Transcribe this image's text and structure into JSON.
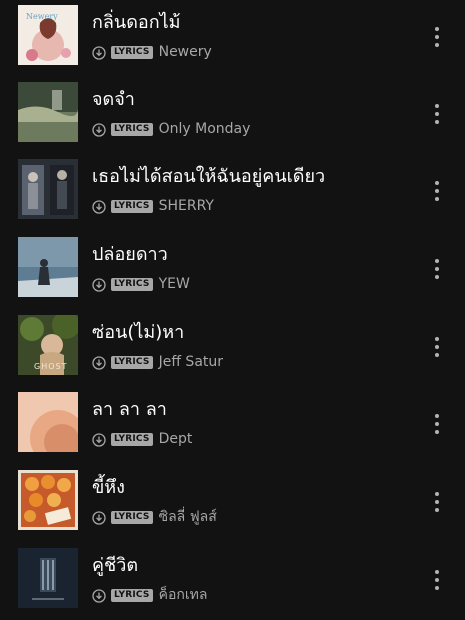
{
  "colors": {
    "background": "#121212",
    "title_text": "#ffffff",
    "secondary_text": "#a7a7a7",
    "badge_bg": "#a7a7a7"
  },
  "icons": {
    "downloaded": "downloaded-icon",
    "more": "more-options-icon"
  },
  "tracks": [
    {
      "title": "กลิ่นดอกไม้",
      "badge": "LYRICS",
      "artist": "Newery"
    },
    {
      "title": "จดจำ",
      "badge": "LYRICS",
      "artist": "Only Monday"
    },
    {
      "title": "เธอไม่ได้สอนให้ฉันอยู่คนเดียว",
      "badge": "LYRICS",
      "artist": "SHERRY"
    },
    {
      "title": "ปล่อยดาว",
      "badge": "LYRICS",
      "artist": "YEW"
    },
    {
      "title": "ซ่อน(ไม่)หา",
      "badge": "LYRICS",
      "artist": "Jeff Satur"
    },
    {
      "title": "ลา ลา ลา",
      "badge": "LYRICS",
      "artist": "Dept"
    },
    {
      "title": "ขี้หึง",
      "badge": "LYRICS",
      "artist": "ซิลลี่ ฟูลส์"
    },
    {
      "title": "คู่ชีวิต",
      "badge": "LYRICS",
      "artist": "ค็อกเทล"
    }
  ]
}
